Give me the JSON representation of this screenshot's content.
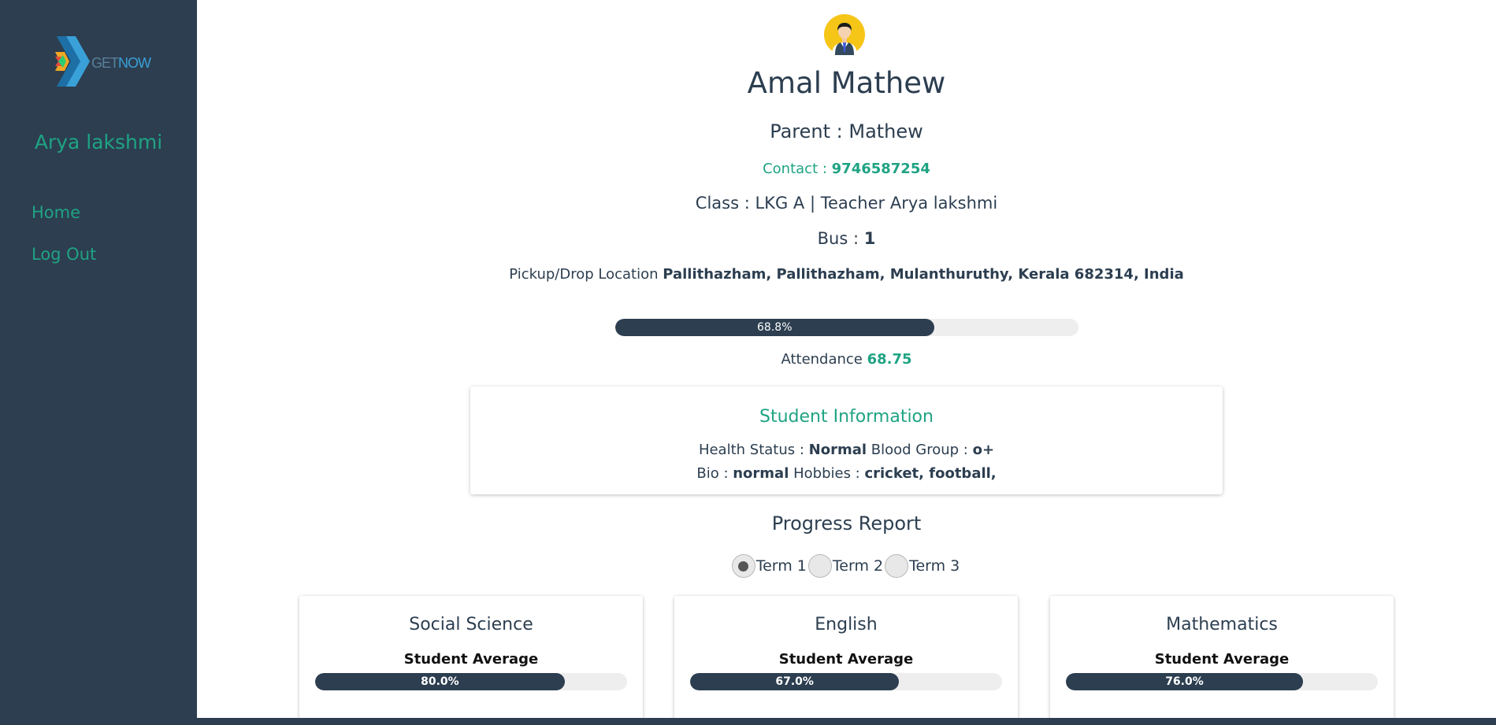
{
  "sidebar": {
    "logo_part1": "GET",
    "logo_part2": "NOW",
    "user_name": "Arya lakshmi",
    "nav": [
      {
        "label": "Home"
      },
      {
        "label": "Log Out"
      }
    ]
  },
  "student": {
    "name": "Amal Mathew",
    "parent_label": "Parent : ",
    "parent": "Mathew",
    "contact_label": "Contact : ",
    "contact": "9746587254",
    "class_label": "Class : ",
    "class": "LKG A",
    "teacher_label": " | Teacher ",
    "teacher": "Arya lakshmi",
    "bus_label": "Bus : ",
    "bus": "1",
    "location_label": "Pickup/Drop Location ",
    "location": "Pallithazham, Pallithazham, Mulanthuruthy, Kerala 682314, India"
  },
  "attendance": {
    "progress_text": "68.8%",
    "progress_fraction": 0.688,
    "label": "Attendance ",
    "value": "68.75"
  },
  "student_info": {
    "title": "Student Information",
    "health_label": "Health Status : ",
    "health": "Normal",
    "blood_label": " Blood Group : ",
    "blood": "o+",
    "bio_label": "Bio : ",
    "bio": "normal",
    "hobbies_label": " Hobbies : ",
    "hobbies": "cricket, football,"
  },
  "progress_report": {
    "title": "Progress Report",
    "terms": [
      {
        "label": "Term 1",
        "selected": true
      },
      {
        "label": "Term 2",
        "selected": false
      },
      {
        "label": "Term 3",
        "selected": false
      }
    ],
    "subjects": [
      {
        "name": "Social Science",
        "sub": "Student Average",
        "progress_text": "80.0%",
        "fraction": 0.8
      },
      {
        "name": "English",
        "sub": "Student Average",
        "progress_text": "67.0%",
        "fraction": 0.67
      },
      {
        "name": "Mathematics",
        "sub": "Student Average",
        "progress_text": "76.0%",
        "fraction": 0.76
      }
    ]
  },
  "colors": {
    "sidebar_bg": "#2c3e50",
    "accent_green": "#1fa383",
    "progress_fill": "#2c3e50",
    "progress_track": "#eeeeee"
  }
}
